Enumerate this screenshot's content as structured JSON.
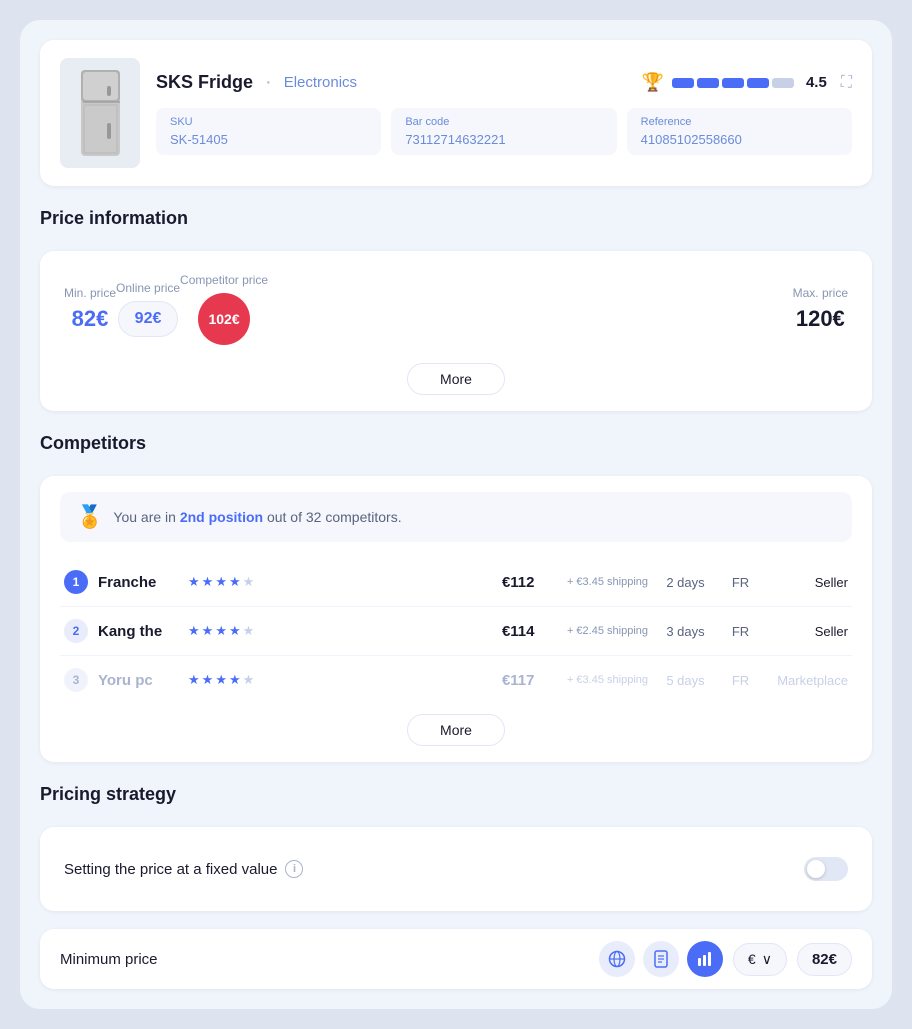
{
  "product": {
    "name": "SKS Fridge",
    "category": "Electronics",
    "rating_score": "4.5",
    "sku_label": "SKU",
    "sku_value": "SK-51405",
    "barcode_label": "Bar code",
    "barcode_value": "73112714632221",
    "reference_label": "Reference",
    "reference_value": "41085102558660"
  },
  "price_info": {
    "section_title": "Price information",
    "min_price_label": "Min. price",
    "min_price_value": "82€",
    "online_price_label": "Online price",
    "online_price_value": "92€",
    "competitor_price_label": "Competitor price",
    "competitor_price_value": "102€",
    "max_price_label": "Max. price",
    "max_price_value": "120€",
    "more_button": "More"
  },
  "competitors": {
    "section_title": "Competitors",
    "position_text_before": "You are in",
    "position_highlight": "2nd position",
    "position_text_after": "out of 32 competitors.",
    "items": [
      {
        "rank": "1",
        "name": "Franche",
        "stars": [
          1,
          1,
          1,
          1,
          0
        ],
        "price": "€112",
        "shipping": "+ €3.45 shipping",
        "days": "2 days",
        "country": "FR",
        "type": "Seller",
        "muted": false
      },
      {
        "rank": "2",
        "name": "Kang the",
        "stars": [
          1,
          1,
          1,
          1,
          0
        ],
        "price": "€114",
        "shipping": "+ €2.45 shipping",
        "days": "3 days",
        "country": "FR",
        "type": "Seller",
        "muted": false
      },
      {
        "rank": "3",
        "name": "Yoru pc",
        "stars": [
          1,
          1,
          1,
          1,
          0
        ],
        "price": "€117",
        "shipping": "+ €3.45 shipping",
        "days": "5 days",
        "country": "FR",
        "type": "Marketplace",
        "muted": true
      }
    ],
    "more_button": "More"
  },
  "pricing_strategy": {
    "section_title": "Pricing strategy",
    "fixed_price_label": "Setting the price at a fixed value",
    "min_price_label": "Minimum price",
    "currency": "€",
    "currency_dropdown": "€  ∨",
    "min_price_value": "82€"
  }
}
